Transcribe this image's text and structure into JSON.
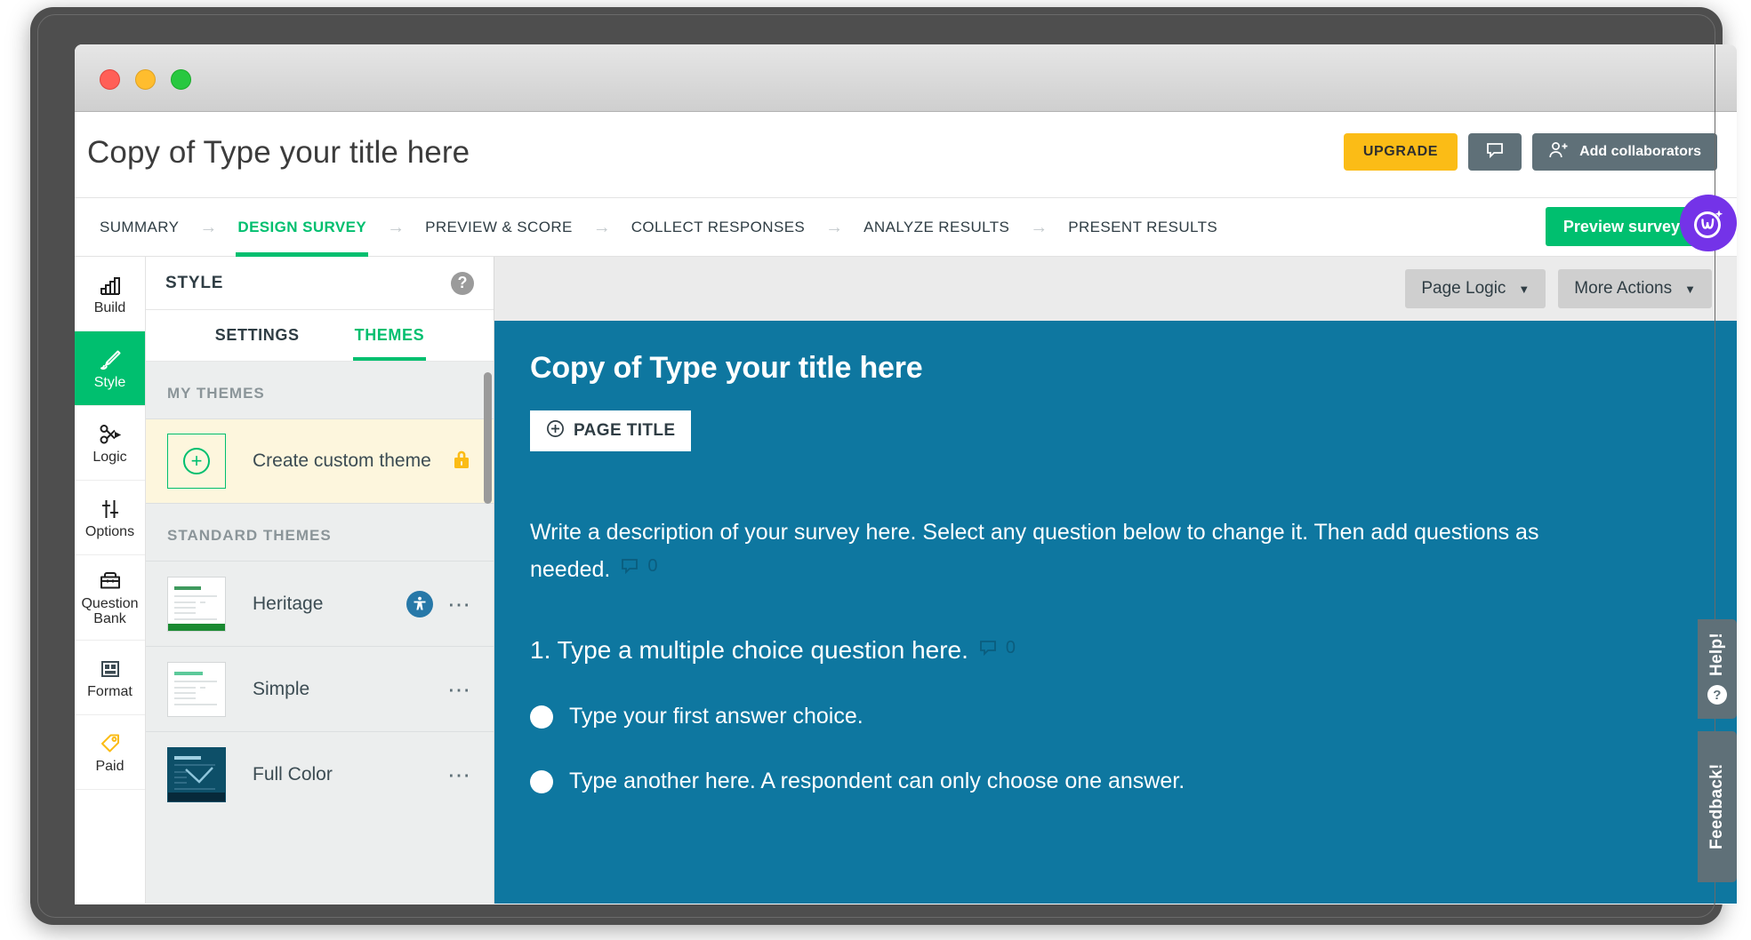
{
  "window": {
    "traffic_lights": [
      "close",
      "minimize",
      "maximize"
    ]
  },
  "header": {
    "title": "Copy of Type your title here",
    "upgrade_label": "UPGRADE",
    "comment_icon": "speech-bubble-icon",
    "collaborators_label": "Add collaborators",
    "collaborators_icon": "add-user-icon"
  },
  "nav": {
    "items": [
      {
        "label": "SUMMARY",
        "active": false
      },
      {
        "label": "DESIGN SURVEY",
        "active": true
      },
      {
        "label": "PREVIEW & SCORE",
        "active": false
      },
      {
        "label": "COLLECT RESPONSES",
        "active": false
      },
      {
        "label": "ANALYZE RESULTS",
        "active": false
      },
      {
        "label": "PRESENT RESULTS",
        "active": false
      }
    ],
    "preview_label": "Preview survey",
    "badge_icon": "wootric-logo-icon"
  },
  "rail": {
    "items": [
      {
        "label": "Build",
        "icon": "build-icon",
        "active": false
      },
      {
        "label": "Style",
        "icon": "brush-icon",
        "active": true
      },
      {
        "label": "Logic",
        "icon": "logic-branch-icon",
        "active": false
      },
      {
        "label": "Options",
        "icon": "sliders-icon",
        "active": false
      },
      {
        "label": "Question Bank",
        "icon": "question-bank-icon",
        "active": false
      },
      {
        "label": "Format",
        "icon": "format-layout-icon",
        "active": false
      },
      {
        "label": "Paid",
        "icon": "price-tag-icon",
        "active": false
      }
    ]
  },
  "style_panel": {
    "heading": "STYLE",
    "help_icon": "question-mark-icon",
    "tabs": [
      {
        "label": "SETTINGS",
        "active": false
      },
      {
        "label": "THEMES",
        "active": true
      }
    ],
    "my_themes_heading": "MY THEMES",
    "create_custom_label": "Create custom theme",
    "create_custom_icon": "plus-circle-icon",
    "lock_icon": "lock-icon",
    "standard_themes_heading": "STANDARD THEMES",
    "standard_themes": [
      {
        "name": "Heritage",
        "accessible": true,
        "menu_icon": "ellipsis-icon",
        "accessibility_icon": "accessibility-icon",
        "accent": "#1a8a31",
        "dark": false
      },
      {
        "name": "Simple",
        "accessible": false,
        "menu_icon": "ellipsis-icon",
        "accent": "#5cc99a",
        "dark": false
      },
      {
        "name": "Full Color",
        "accessible": false,
        "menu_icon": "ellipsis-icon",
        "accent": "#0d4f68",
        "dark": true
      }
    ]
  },
  "canvas": {
    "page_logic_label": "Page Logic",
    "more_actions_label": "More Actions",
    "caret_icon": "chevron-down-icon",
    "survey": {
      "title": "Copy of Type your title here",
      "page_title_button": "PAGE TITLE",
      "page_title_icon": "plus-circle-icon",
      "description": "Write a description of your survey here. Select any question below to change it. Then add questions as needed.",
      "description_comment_count": "0",
      "question_text": "1. Type a multiple choice question here.",
      "question_comment_count": "0",
      "comment_icon": "speech-bubble-icon",
      "choices": [
        "Type your first answer choice.",
        "Type another here. A respondent can only choose one answer."
      ]
    }
  },
  "side_tabs": {
    "help_label": "Help!",
    "help_icon": "question-mark-icon",
    "feedback_label": "Feedback!"
  },
  "colors": {
    "brand_green": "#00bf6f",
    "upgrade_yellow": "#fbbc16",
    "slate": "#5f7078",
    "survey_teal": "#0e77a0",
    "purple_badge": "#7433e8",
    "custom_theme_bg": "#fdf6dd"
  }
}
